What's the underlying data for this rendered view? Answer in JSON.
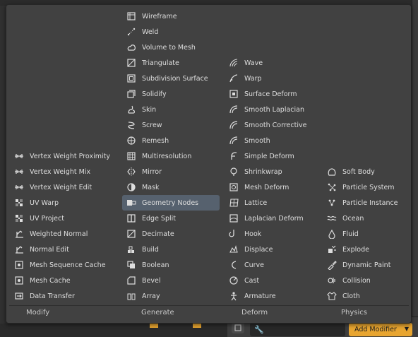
{
  "menu": {
    "categories": [
      {
        "header": "Modify",
        "items": [
          {
            "label": "Vertex Weight Proximity",
            "icon": "vertex-weight-icon"
          },
          {
            "label": "Vertex Weight Mix",
            "icon": "vertex-weight-icon"
          },
          {
            "label": "Vertex Weight Edit",
            "icon": "vertex-weight-icon"
          },
          {
            "label": "UV Warp",
            "icon": "checker-icon"
          },
          {
            "label": "UV Project",
            "icon": "checker-icon"
          },
          {
            "label": "Weighted Normal",
            "icon": "normal-icon"
          },
          {
            "label": "Normal Edit",
            "icon": "normal-icon"
          },
          {
            "label": "Mesh Sequence Cache",
            "icon": "cache-icon"
          },
          {
            "label": "Mesh Cache",
            "icon": "cache-icon"
          },
          {
            "label": "Data Transfer",
            "icon": "data-transfer-icon"
          }
        ]
      },
      {
        "header": "Generate",
        "items": [
          {
            "label": "Wireframe",
            "icon": "wireframe-icon"
          },
          {
            "label": "Weld",
            "icon": "weld-icon"
          },
          {
            "label": "Volume to Mesh",
            "icon": "volume-icon"
          },
          {
            "label": "Triangulate",
            "icon": "triangulate-icon"
          },
          {
            "label": "Subdivision Surface",
            "icon": "subdivision-icon"
          },
          {
            "label": "Solidify",
            "icon": "solidify-icon"
          },
          {
            "label": "Skin",
            "icon": "skin-icon"
          },
          {
            "label": "Screw",
            "icon": "screw-icon"
          },
          {
            "label": "Remesh",
            "icon": "remesh-icon"
          },
          {
            "label": "Multiresolution",
            "icon": "multires-icon"
          },
          {
            "label": "Mirror",
            "icon": "mirror-icon"
          },
          {
            "label": "Mask",
            "icon": "mask-icon"
          },
          {
            "label": "Geometry Nodes",
            "icon": "geometry-nodes-icon"
          },
          {
            "label": "Edge Split",
            "icon": "edge-split-icon"
          },
          {
            "label": "Decimate",
            "icon": "decimate-icon"
          },
          {
            "label": "Build",
            "icon": "build-icon"
          },
          {
            "label": "Boolean",
            "icon": "boolean-icon"
          },
          {
            "label": "Bevel",
            "icon": "bevel-icon"
          },
          {
            "label": "Array",
            "icon": "array-icon"
          }
        ]
      },
      {
        "header": "Deform",
        "items": [
          {
            "label": "Wave",
            "icon": "wave-icon"
          },
          {
            "label": "Warp",
            "icon": "warp-icon"
          },
          {
            "label": "Surface Deform",
            "icon": "surface-deform-icon"
          },
          {
            "label": "Smooth Laplacian",
            "icon": "smooth-icon"
          },
          {
            "label": "Smooth Corrective",
            "icon": "smooth-icon"
          },
          {
            "label": "Smooth",
            "icon": "smooth-icon"
          },
          {
            "label": "Simple Deform",
            "icon": "simple-deform-icon"
          },
          {
            "label": "Shrinkwrap",
            "icon": "shrinkwrap-icon"
          },
          {
            "label": "Mesh Deform",
            "icon": "mesh-deform-icon"
          },
          {
            "label": "Lattice",
            "icon": "lattice-icon"
          },
          {
            "label": "Laplacian Deform",
            "icon": "laplacian-icon"
          },
          {
            "label": "Hook",
            "icon": "hook-icon"
          },
          {
            "label": "Displace",
            "icon": "displace-icon"
          },
          {
            "label": "Curve",
            "icon": "curve-icon"
          },
          {
            "label": "Cast",
            "icon": "cast-icon"
          },
          {
            "label": "Armature",
            "icon": "armature-icon"
          }
        ]
      },
      {
        "header": "Physics",
        "items": [
          {
            "label": "Soft Body",
            "icon": "soft-body-icon"
          },
          {
            "label": "Particle System",
            "icon": "particle-system-icon"
          },
          {
            "label": "Particle Instance",
            "icon": "particle-instance-icon"
          },
          {
            "label": "Ocean",
            "icon": "ocean-icon"
          },
          {
            "label": "Fluid",
            "icon": "fluid-icon"
          },
          {
            "label": "Explode",
            "icon": "explode-icon"
          },
          {
            "label": "Dynamic Paint",
            "icon": "dynamic-paint-icon"
          },
          {
            "label": "Collision",
            "icon": "collision-icon"
          },
          {
            "label": "Cloth",
            "icon": "cloth-icon"
          }
        ]
      }
    ],
    "highlighted": "Geometry Nodes"
  },
  "properties": {
    "add_modifier_label": "Add Modifier",
    "accent": "#e8a530"
  },
  "colors": {
    "menu_bg": "#414141",
    "highlight": "#56616e",
    "text": "#dedede"
  }
}
